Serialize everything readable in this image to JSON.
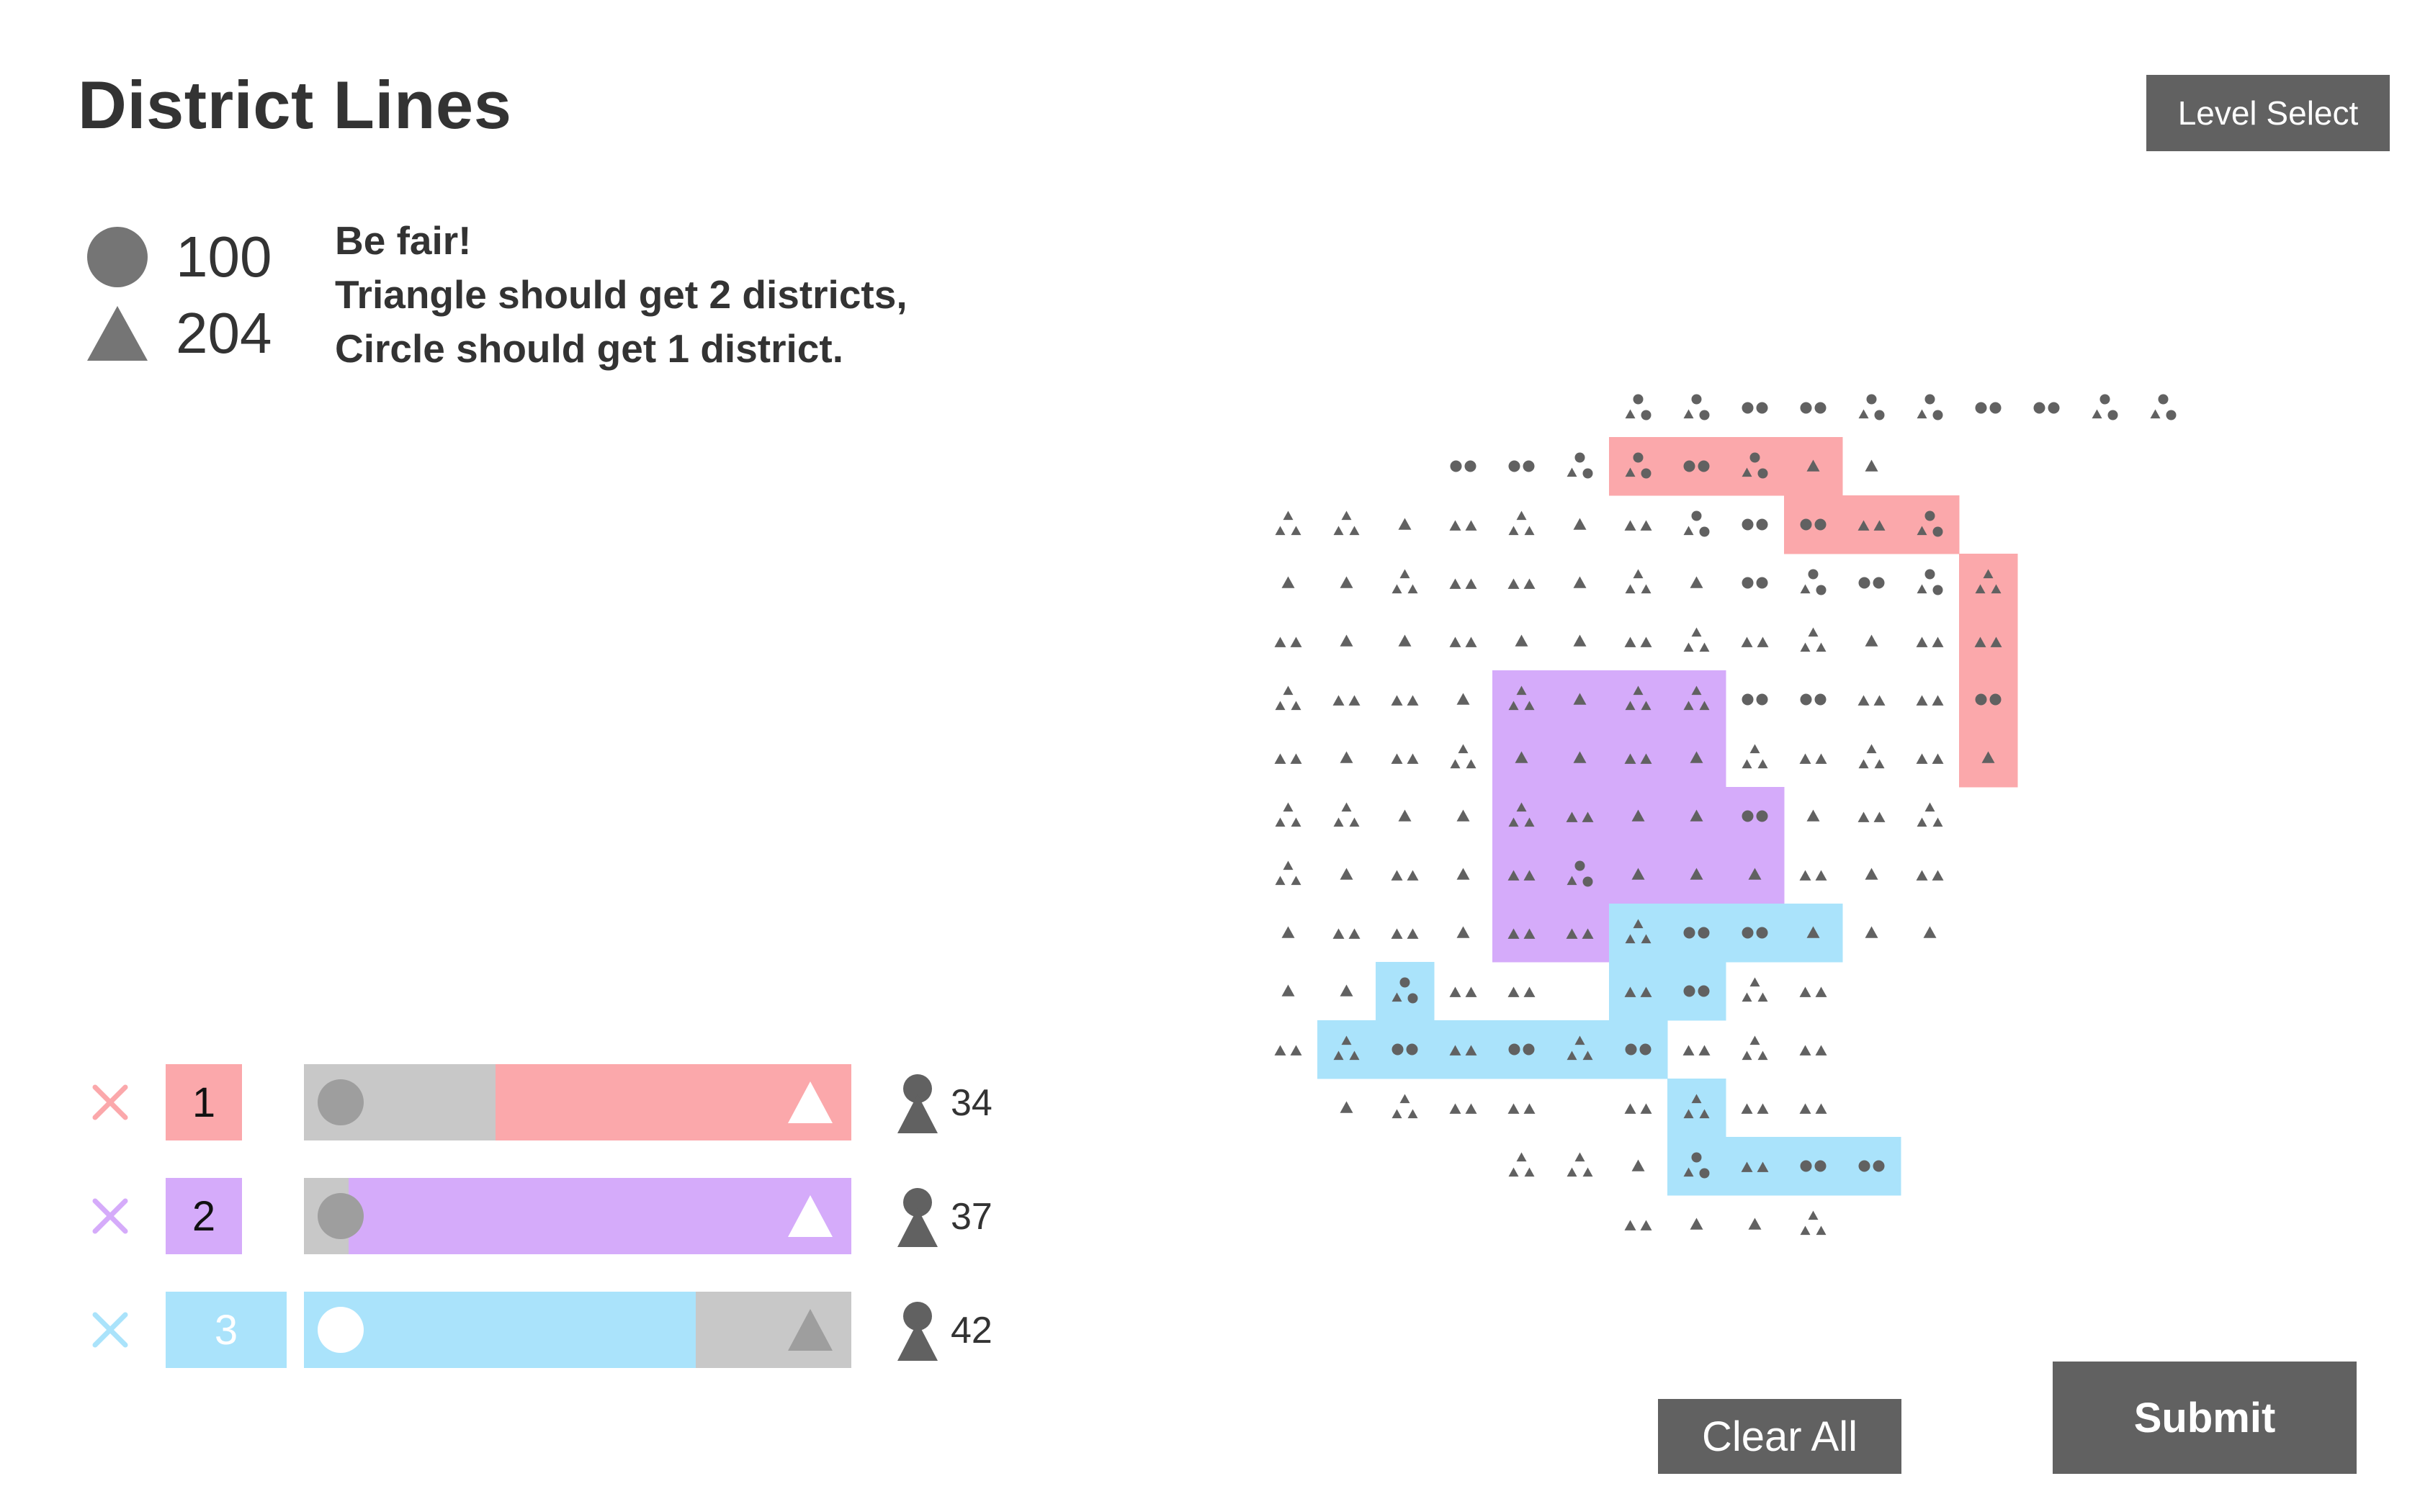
{
  "title": "District Lines",
  "level_select_label": "Level Select",
  "clear_all_label": "Clear All",
  "submit_label": "Submit",
  "totals": {
    "circle": "100",
    "triangle": "204"
  },
  "instructions": [
    "Be fair!",
    "Triangle should get 2 districts,",
    "Circle should get 1 district."
  ],
  "colors": {
    "district_1": "#fba8ab",
    "district_2": "#d5abfa",
    "district_3": "#aae3fb",
    "bar_bg": "#c8c8c8",
    "voter_gray": "#616161"
  },
  "districts": [
    {
      "id": "1",
      "color": "#fba8ab",
      "circle_fraction": 0.35,
      "majority": "triangle",
      "count": "34"
    },
    {
      "id": "2",
      "color": "#d5abfa",
      "circle_fraction": 0.08,
      "majority": "triangle",
      "count": "37"
    },
    {
      "id": "3",
      "color": "#aae3fb",
      "circle_fraction": 0.72,
      "majority": "circle",
      "count": "42"
    }
  ],
  "grid": {
    "rows": [
      "......OOOOOOOOOO",
      "...OOO1111T.....",
      "TTTTTTTOO111....",
      "TTTTTTTTOOOO1...",
      "TTTTTTTTTTTT1...",
      "TTTT2222OOTT1...",
      "TTTT2222TTTT1...",
      "TTTT22222TTT....",
      "TTTT22222TTT....",
      "TTTT223333TT....",
      "TT3TT.33TT......",
      "T333333TTT......",
      ".TTTT.T3TT......",
      "....TTT3333.....",
      "......TTTT......"
    ]
  }
}
